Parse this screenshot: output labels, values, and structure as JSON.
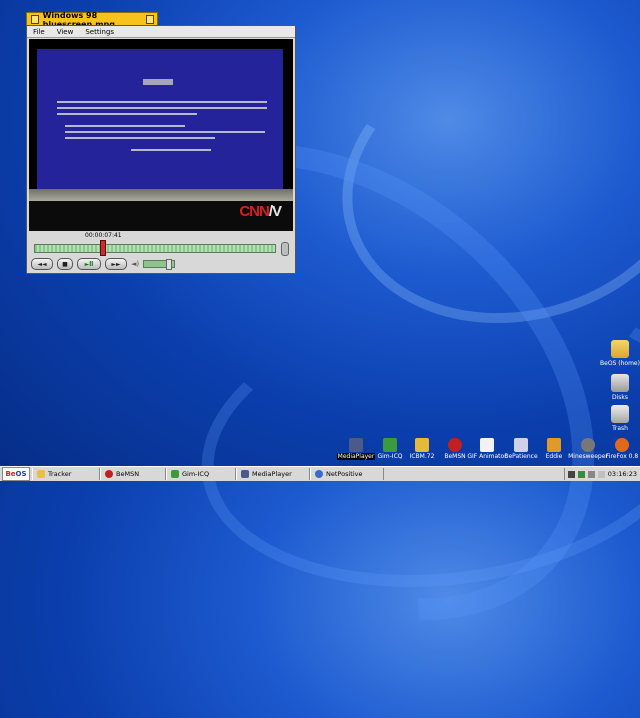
{
  "window": {
    "title": "Windows 98 bluescreen.mpg",
    "menu": [
      "File",
      "View",
      "Settings"
    ],
    "timecode": "00:00:07:41",
    "video_logo": {
      "left": "CNN",
      "right": "/V"
    },
    "progress": 0.27,
    "volume": 0.8
  },
  "desktop_icons": [
    {
      "label": "BeOS (home)",
      "icon": "folder-icon"
    },
    {
      "label": "Disks",
      "icon": "disks-icon"
    },
    {
      "label": "Trash",
      "icon": "trash-icon"
    }
  ],
  "strip_icons": [
    {
      "label": "MediaPlayer",
      "icon": "media-player-icon",
      "color": "#4a5a8a"
    },
    {
      "label": "Gim-ICQ",
      "icon": "gim-icq-icon",
      "color": "#3c9a3c"
    },
    {
      "label": "ICBM.72",
      "icon": "folder-icon",
      "color": "#e5b93a"
    },
    {
      "label": "BeMSN",
      "icon": "bemsn-icon",
      "color": "#c02020"
    },
    {
      "label": "GIF Animator",
      "icon": "gif-animator-icon",
      "color": "#f2f2f2"
    },
    {
      "label": "BePatience",
      "icon": "bepatience-icon",
      "color": "#d0d0e8"
    },
    {
      "label": "Eddie",
      "icon": "eddie-icon",
      "color": "#e09a2a"
    },
    {
      "label": "Minesweeper",
      "icon": "minesweeper-icon",
      "color": "#777777"
    },
    {
      "label": "FireFox 0.8",
      "icon": "firefox-icon",
      "color": "#e06a1a"
    }
  ],
  "taskbar": {
    "logo_left": "Be",
    "logo_right": "OS",
    "tasks": [
      {
        "label": "Tracker",
        "icon": "tracker-icon",
        "color": "#e8c048"
      },
      {
        "label": "BeMSN",
        "icon": "bemsn-icon",
        "color": "#c02020"
      },
      {
        "label": "Gim-ICQ",
        "icon": "gim-icq-icon",
        "color": "#3c9a3c"
      },
      {
        "label": "MediaPlayer",
        "icon": "media-player-icon",
        "color": "#4a5a8a"
      },
      {
        "label": "NetPositive",
        "icon": "netpositive-icon",
        "color": "#3a6acb"
      }
    ],
    "clock": "03:16:23"
  }
}
